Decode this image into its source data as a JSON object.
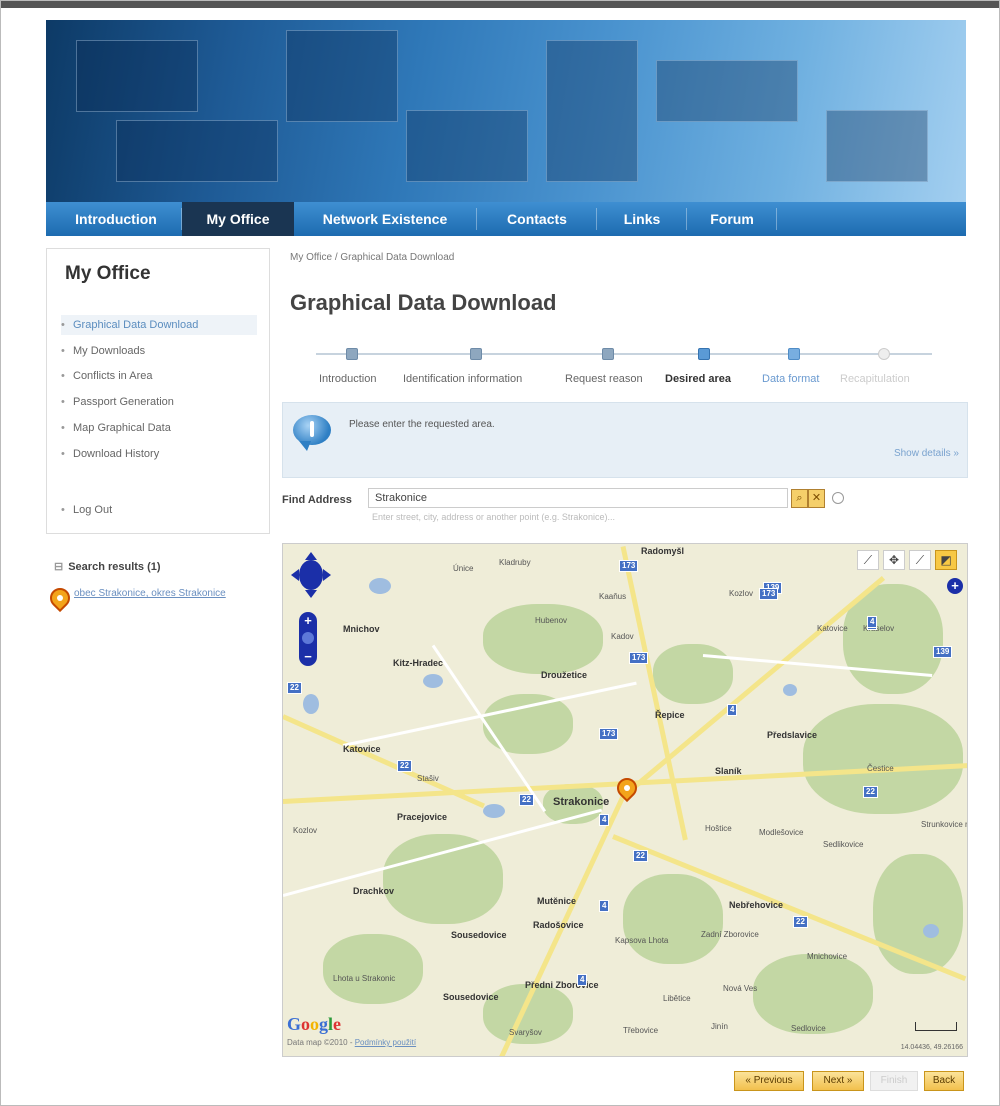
{
  "nav": {
    "tabs": [
      "Introduction",
      "My Office",
      "Network Existence",
      "Contacts",
      "Links",
      "Forum"
    ]
  },
  "sidebar": {
    "title": "My Office",
    "items": [
      "Graphical Data Download",
      "My Downloads",
      "Conflicts in Area",
      "Passport Generation",
      "Map Graphical Data",
      "Download History"
    ],
    "logout": "Log Out"
  },
  "search_results": {
    "heading": "Search results (1)",
    "expander": "⊟",
    "item": "obec Strakonice, okres Strakonice"
  },
  "breadcrumb": "My Office / Graphical Data Download",
  "page_title": "Graphical Data Download",
  "wizard": {
    "steps": [
      "Introduction",
      "Identification information",
      "Request reason",
      "Desired area",
      "Data format",
      "Recapitulation"
    ],
    "current": 3
  },
  "info": {
    "text": "Please enter the requested area.",
    "show_details": "Show details »"
  },
  "find": {
    "label": "Find Address",
    "value": "Strakonice",
    "hint": "Enter street, city, address or another point (e.g. Strakonice)...",
    "search_icon": "magnifier-icon",
    "clear_icon": "close-icon"
  },
  "map": {
    "copyright": "Data map ©2010 - ",
    "terms": "Podmínky použití",
    "coords": "14.04436, 49.26166",
    "places": [
      "Radomyšl",
      "Únice",
      "Kladruby",
      "Kaaňus",
      "Mnichov",
      "Kraselov",
      "Hubenov",
      "Cehnice",
      "Kadov",
      "Drahonice",
      "Kozlov",
      "Katovice",
      "Kozlov",
      "Kitz-Hradec",
      "Droužetice",
      "Řepice",
      "Předslavice",
      "Stašiv",
      "Katovice",
      "Strakonice",
      "Čestice",
      "Slaník",
      "Pracejovice",
      "Hoštice",
      "Modlešovice",
      "Sedlikovice",
      "Drachkov",
      "Mutěnice",
      "Radošovice",
      "Nebřehovice",
      "Sousedovice",
      "Kapsova Lhota",
      "Zadní Zborovice",
      "Předni Zborovice",
      "Lhota u Strakonic",
      "Němčice",
      "Sousedovice",
      "Libětice",
      "Nová Ves",
      "Mnichovice",
      "Jinín",
      "Sedlovice",
      "Třebovice",
      "Svaryšov",
      "Strunkovice nad Volyňkou",
      "Čejetice"
    ],
    "shields": [
      "173",
      "139",
      "139",
      "4",
      "4",
      "4",
      "4",
      "22",
      "22",
      "22",
      "22",
      "173",
      "173",
      "22",
      "4",
      "4",
      "173",
      "22"
    ]
  },
  "buttons": {
    "previous": "« Previous",
    "next": "Next »",
    "finish": "Finish",
    "back": "Back"
  }
}
